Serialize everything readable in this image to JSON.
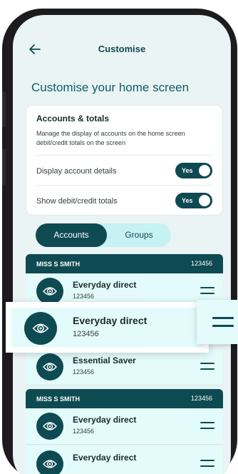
{
  "header": {
    "title": "Customise"
  },
  "page": {
    "title": "Customise your home screen"
  },
  "card": {
    "title": "Accounts & totals",
    "description": "Manage the display of accounts on the home screen debit/credit totals on the screen",
    "rows": [
      {
        "label": "Display account details",
        "toggle": "Yes"
      },
      {
        "label": "Show debit/credit totals",
        "toggle": "Yes"
      }
    ]
  },
  "segmented": {
    "tabs": [
      "Accounts",
      "Groups"
    ],
    "selected": "Accounts"
  },
  "groups": [
    {
      "name": "MISS S SMITH",
      "number": "123456",
      "accounts": [
        {
          "name": "Everyday direct",
          "number": "123456"
        },
        {
          "name": "Essential Saver",
          "number": "123456"
        }
      ]
    },
    {
      "name": "MISS S SMITH",
      "number": "123456",
      "accounts": [
        {
          "name": "Everyday direct",
          "number": "123456"
        },
        {
          "name": "Everyday direct",
          "number": ""
        }
      ]
    }
  ],
  "dragging": {
    "name": "Everyday direct",
    "number": "123456"
  },
  "colors": {
    "primary": "#0e4a52",
    "background": "#eaf4f4",
    "row": "#e3fbfb",
    "segment": "#c6f2f4"
  }
}
